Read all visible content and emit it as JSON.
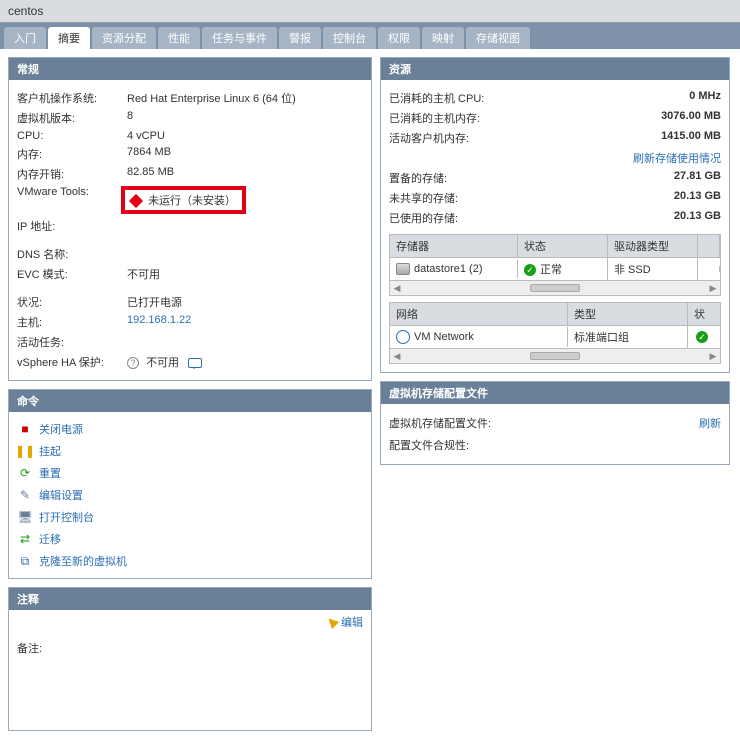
{
  "title": "centos",
  "tabs": [
    {
      "label": "入门",
      "active": false
    },
    {
      "label": "摘要",
      "active": true
    },
    {
      "label": "资源分配",
      "active": false
    },
    {
      "label": "性能",
      "active": false
    },
    {
      "label": "任务与事件",
      "active": false
    },
    {
      "label": "警报",
      "active": false
    },
    {
      "label": "控制台",
      "active": false
    },
    {
      "label": "权限",
      "active": false
    },
    {
      "label": "映射",
      "active": false
    },
    {
      "label": "存储视图",
      "active": false
    }
  ],
  "general": {
    "title": "常规",
    "rows": [
      {
        "k": "客户机操作系统:",
        "v": "Red Hat Enterprise Linux 6 (64 位)"
      },
      {
        "k": "虚拟机版本:",
        "v": "8"
      },
      {
        "k": "CPU:",
        "v": "4 vCPU"
      },
      {
        "k": "内存:",
        "v": "7864 MB"
      },
      {
        "k": "内存开销:",
        "v": "82.85 MB"
      }
    ],
    "vmtools": {
      "k": "VMware Tools:",
      "v": "未运行（未安装）"
    },
    "ipaddr": {
      "k": "IP 地址:",
      "v": ""
    },
    "dns": {
      "k": "DNS 名称:",
      "v": ""
    },
    "evc": {
      "k": "EVC 模式:",
      "v": "不可用"
    },
    "state": {
      "k": "状况:",
      "v": "已打开电源"
    },
    "host": {
      "k": "主机:",
      "v": "192.168.1.22"
    },
    "activetask": {
      "k": "活动任务:",
      "v": ""
    },
    "ha": {
      "k": "vSphere HA 保护:",
      "v": "不可用"
    }
  },
  "commands": {
    "title": "命令",
    "items": [
      {
        "label": "关闭电源",
        "icon": "ic-poweroff",
        "name": "cmd-poweroff"
      },
      {
        "label": "挂起",
        "icon": "ic-suspend",
        "name": "cmd-suspend"
      },
      {
        "label": "重置",
        "icon": "ic-reset",
        "name": "cmd-reset"
      },
      {
        "label": "编辑设置",
        "icon": "ic-edit",
        "name": "cmd-edit-settings"
      },
      {
        "label": "打开控制台",
        "icon": "ic-console",
        "name": "cmd-open-console"
      },
      {
        "label": "迁移",
        "icon": "ic-migrate",
        "name": "cmd-migrate"
      },
      {
        "label": "克隆至新的虚拟机",
        "icon": "ic-clone",
        "name": "cmd-clone"
      }
    ]
  },
  "notes": {
    "title": "注释",
    "edit": "编辑",
    "remark_label": "备注:"
  },
  "resources": {
    "title": "资源",
    "rows": [
      {
        "lbl": "已消耗的主机 CPU:",
        "val": "0 MHz"
      },
      {
        "lbl": "已消耗的主机内存:",
        "val": "3076.00 MB"
      },
      {
        "lbl": "活动客户机内存:",
        "val": "1415.00 MB"
      }
    ],
    "refresh_link": "刷新存储使用情况",
    "rows2": [
      {
        "lbl": "置备的存储:",
        "val": "27.81 GB"
      },
      {
        "lbl": "未共享的存储:",
        "val": "20.13 GB"
      },
      {
        "lbl": "已使用的存储:",
        "val": "20.13 GB"
      }
    ],
    "store_head": [
      "存储器",
      "状态",
      "驱动器类型"
    ],
    "store_row": {
      "name": "datastore1 (2)",
      "status": "正常",
      "type": "非 SSD"
    },
    "net_head": [
      "网络",
      "类型",
      "状"
    ],
    "net_row": {
      "name": "VM Network",
      "type": "标准端口组"
    }
  },
  "storage_profile": {
    "title": "虚拟机存储配置文件",
    "refresh": "刷新",
    "rows": [
      {
        "lbl": "虚拟机存储配置文件:",
        "val": ""
      },
      {
        "lbl": "配置文件合规性:",
        "val": ""
      }
    ]
  }
}
